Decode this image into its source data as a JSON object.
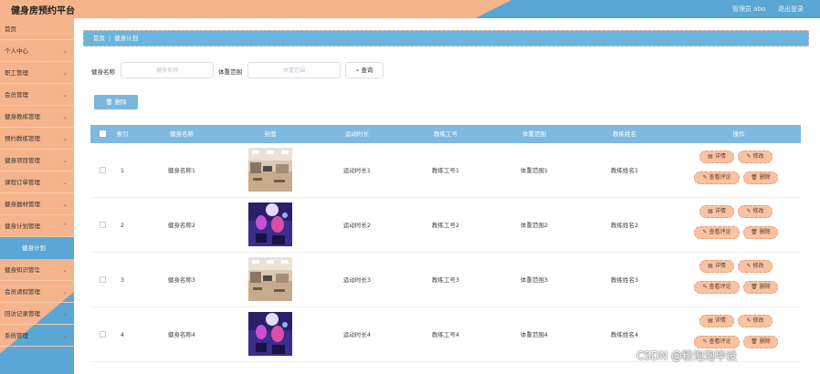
{
  "header": {
    "title": "健身房预约平台",
    "user": "管理员 abo",
    "logout": "退出登录"
  },
  "sidebar": {
    "items": [
      {
        "label": "首页",
        "arrow": ""
      },
      {
        "label": "个人中心",
        "arrow": "⌄"
      },
      {
        "label": "职工管理",
        "arrow": "⌄"
      },
      {
        "label": "会员管理",
        "arrow": "⌄"
      },
      {
        "label": "健身教练管理",
        "arrow": "⌄"
      },
      {
        "label": "预约教练管理",
        "arrow": "⌄"
      },
      {
        "label": "健身项目管理",
        "arrow": "⌄"
      },
      {
        "label": "课程订单管理",
        "arrow": "⌄"
      },
      {
        "label": "健身器材管理",
        "arrow": "⌄"
      },
      {
        "label": "健身计划管理",
        "arrow": "⌃"
      }
    ],
    "subitem": "健身计划",
    "items_after": [
      {
        "label": "健身知识管理",
        "arrow": "⌄"
      },
      {
        "label": "会员请假管理",
        "arrow": "⌄"
      },
      {
        "label": "回访记录管理",
        "arrow": "⌄"
      },
      {
        "label": "系统管理",
        "arrow": "⌄"
      }
    ]
  },
  "breadcrumb": {
    "home": "首页",
    "sep": "|",
    "current": "健身计划"
  },
  "search": {
    "name_label": "健身名称",
    "name_placeholder": "健身名称",
    "range_label": "体重范围",
    "range_placeholder": "体重范围",
    "button": "查询"
  },
  "toolbar": {
    "delete_label": "删除"
  },
  "table": {
    "headers": [
      "索引",
      "健身名称",
      "封面",
      "运动时长",
      "教练工号",
      "体重范围",
      "教练姓名",
      "操作"
    ],
    "rows": [
      {
        "index": "1",
        "name": "健身名称1",
        "duration": "运动时长1",
        "coach_id": "教练工号1",
        "range": "体重范围1",
        "coach_name": "教练姓名1",
        "cover": "gym"
      },
      {
        "index": "2",
        "name": "健身名称2",
        "duration": "运动时长2",
        "coach_id": "教练工号2",
        "range": "体重范围2",
        "coach_name": "教练姓名2",
        "cover": "spin"
      },
      {
        "index": "3",
        "name": "健身名称3",
        "duration": "运动时长3",
        "coach_id": "教练工号3",
        "range": "体重范围3",
        "coach_name": "教练姓名3",
        "cover": "gym"
      },
      {
        "index": "4",
        "name": "健身名称4",
        "duration": "运动时长4",
        "coach_id": "教练工号4",
        "range": "体重范围4",
        "coach_name": "教练姓名4",
        "cover": "spin"
      }
    ],
    "actions": {
      "detail": "详情",
      "edit": "修改",
      "comments": "查看评论",
      "delete": "删除"
    }
  },
  "watermark": "CSDN @粉泡泡毕设",
  "colors": {
    "peach": "#f6b48d",
    "blue": "#5aa6d4",
    "table_header": "#7ebae0",
    "action_btn": "#f8c3a3"
  }
}
